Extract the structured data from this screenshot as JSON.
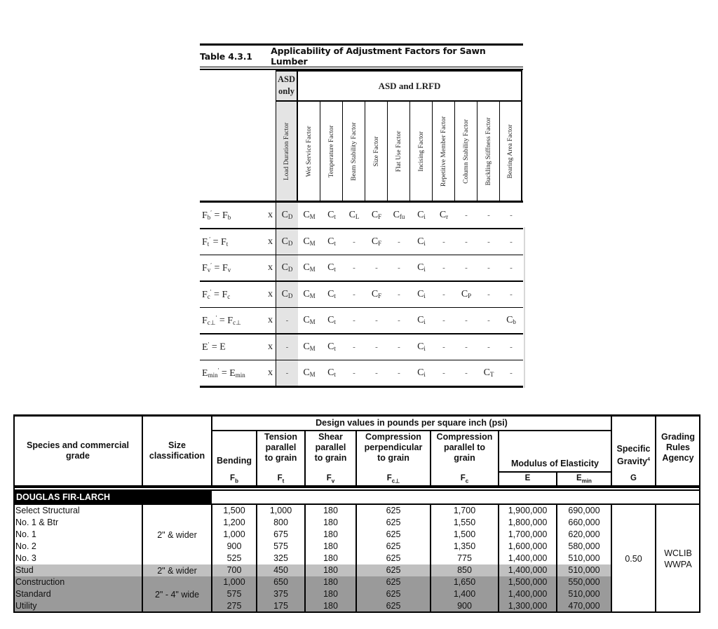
{
  "adjustment_table": {
    "table_number": "Table 4.3.1",
    "title": "Applicability of Adjustment Factors for Sawn Lumber",
    "group_headers": {
      "asd_only": [
        "ASD",
        "only"
      ],
      "asd_and_lrfd": "ASD and LRFD"
    },
    "factor_columns": [
      "Load Duration Factor",
      "Wet Service Factor",
      "Temperature Factor",
      "Beam Stability Factor",
      "Size Factor",
      "Flat Use Factor",
      "Incising Factor",
      "Repetitive Member Factor",
      "Column Stability Factor",
      "Buckling Stiffness Factor",
      "Bearing Area Factor"
    ],
    "multiply_symbol": "x",
    "rows": [
      {
        "lhs": "F",
        "lhs_sub": "b",
        "rhs": "F",
        "rhs_sub": "b",
        "cells": [
          [
            "C",
            "D"
          ],
          [
            "C",
            "M"
          ],
          [
            "C",
            "t"
          ],
          [
            "C",
            "L"
          ],
          [
            "C",
            "F"
          ],
          [
            "C",
            "fu"
          ],
          [
            "C",
            "i"
          ],
          [
            "C",
            "r"
          ],
          [
            "-",
            ""
          ],
          [
            "-",
            ""
          ],
          [
            "-",
            ""
          ]
        ]
      },
      {
        "lhs": "F",
        "lhs_sub": "t",
        "rhs": "F",
        "rhs_sub": "t",
        "cells": [
          [
            "C",
            "D"
          ],
          [
            "C",
            "M"
          ],
          [
            "C",
            "t"
          ],
          [
            "-",
            ""
          ],
          [
            "C",
            "F"
          ],
          [
            "-",
            ""
          ],
          [
            "C",
            "i"
          ],
          [
            "-",
            ""
          ],
          [
            "-",
            ""
          ],
          [
            "-",
            ""
          ],
          [
            "-",
            ""
          ]
        ]
      },
      {
        "lhs": "F",
        "lhs_sub": "v",
        "rhs": "F",
        "rhs_sub": "v",
        "cells": [
          [
            "C",
            "D"
          ],
          [
            "C",
            "M"
          ],
          [
            "C",
            "t"
          ],
          [
            "-",
            ""
          ],
          [
            "-",
            ""
          ],
          [
            "-",
            ""
          ],
          [
            "C",
            "i"
          ],
          [
            "-",
            ""
          ],
          [
            "-",
            ""
          ],
          [
            "-",
            ""
          ],
          [
            "-",
            ""
          ]
        ]
      },
      {
        "lhs": "F",
        "lhs_sub": "c",
        "rhs": "F",
        "rhs_sub": "c",
        "cells": [
          [
            "C",
            "D"
          ],
          [
            "C",
            "M"
          ],
          [
            "C",
            "t"
          ],
          [
            "-",
            ""
          ],
          [
            "C",
            "F"
          ],
          [
            "-",
            ""
          ],
          [
            "C",
            "i"
          ],
          [
            "-",
            ""
          ],
          [
            "C",
            "P"
          ],
          [
            "-",
            ""
          ],
          [
            "-",
            ""
          ]
        ]
      },
      {
        "lhs": "F",
        "lhs_sub": "c⊥",
        "rhs": "F",
        "rhs_sub": "c⊥",
        "cells": [
          [
            "-",
            ""
          ],
          [
            "C",
            "M"
          ],
          [
            "C",
            "t"
          ],
          [
            "-",
            ""
          ],
          [
            "-",
            ""
          ],
          [
            "-",
            ""
          ],
          [
            "C",
            "i"
          ],
          [
            "-",
            ""
          ],
          [
            "-",
            ""
          ],
          [
            "-",
            ""
          ],
          [
            "C",
            "b"
          ]
        ]
      },
      {
        "lhs": "E",
        "lhs_sub": "",
        "rhs": "E",
        "rhs_sub": "",
        "cells": [
          [
            "-",
            ""
          ],
          [
            "C",
            "M"
          ],
          [
            "C",
            "t"
          ],
          [
            "-",
            ""
          ],
          [
            "-",
            ""
          ],
          [
            "-",
            ""
          ],
          [
            "C",
            "i"
          ],
          [
            "-",
            ""
          ],
          [
            "-",
            ""
          ],
          [
            "-",
            ""
          ],
          [
            "-",
            ""
          ]
        ]
      },
      {
        "lhs": "E",
        "lhs_sub": "min",
        "rhs": "E",
        "rhs_sub": "min",
        "cells": [
          [
            "-",
            ""
          ],
          [
            "C",
            "M"
          ],
          [
            "C",
            "t"
          ],
          [
            "-",
            ""
          ],
          [
            "-",
            ""
          ],
          [
            "-",
            ""
          ],
          [
            "C",
            "i"
          ],
          [
            "-",
            ""
          ],
          [
            "-",
            ""
          ],
          [
            "C",
            "T"
          ],
          [
            "-",
            ""
          ]
        ]
      }
    ]
  },
  "design_values_table": {
    "headers": {
      "species": "Species and commercial grade",
      "size": "Size classification",
      "design_values_group": "Design values in pounds per square inch (psi)",
      "bending": "Bending",
      "tension": "Tension parallel to grain",
      "shear": "Shear parallel to grain",
      "comp_perp": "Compression perpendicular to grain",
      "comp_par": "Compression parallel to grain",
      "modulus": "Modulus of Elasticity",
      "specific_gravity": "Specific Gravity",
      "specific_gravity_footnote": "4",
      "agency": "Grading Rules Agency"
    },
    "symbols": {
      "bending": {
        "base": "F",
        "sub": "b"
      },
      "tension": {
        "base": "F",
        "sub": "t"
      },
      "shear": {
        "base": "F",
        "sub": "v"
      },
      "comp_perp": {
        "base": "F",
        "sub": "c⊥"
      },
      "comp_par": {
        "base": "F",
        "sub": "c"
      },
      "e": {
        "base": "E",
        "sub": ""
      },
      "emin": {
        "base": "E",
        "sub": "min"
      },
      "g": {
        "base": "G",
        "sub": ""
      }
    },
    "species_name": "DOUGLAS FIR-LARCH",
    "size_groups": [
      {
        "label": "2\" & wider",
        "rows": 5
      },
      {
        "label": "2\" & wider",
        "rows": 1
      },
      {
        "label": "2\" - 4\" wide",
        "rows": 3
      }
    ],
    "specific_gravity": "0.50",
    "agency": [
      "WCLIB",
      "WWPA"
    ],
    "shade_colors": {
      "white": "#ffffff",
      "stud": "#c0c0c0",
      "light_framing": "#9a9a9a"
    },
    "rows": [
      {
        "grade": "Select Structural",
        "fb": "1,500",
        "ft": "1,000",
        "fv": "180",
        "fcp": "625",
        "fc": "1,700",
        "e": "1,900,000",
        "emin": "690,000",
        "shade": "white"
      },
      {
        "grade": "No. 1 & Btr",
        "fb": "1,200",
        "ft": "800",
        "fv": "180",
        "fcp": "625",
        "fc": "1,550",
        "e": "1,800,000",
        "emin": "660,000",
        "shade": "white"
      },
      {
        "grade": "No. 1",
        "fb": "1,000",
        "ft": "675",
        "fv": "180",
        "fcp": "625",
        "fc": "1,500",
        "e": "1,700,000",
        "emin": "620,000",
        "shade": "white"
      },
      {
        "grade": "No. 2",
        "fb": "900",
        "ft": "575",
        "fv": "180",
        "fcp": "625",
        "fc": "1,350",
        "e": "1,600,000",
        "emin": "580,000",
        "shade": "white"
      },
      {
        "grade": "No. 3",
        "fb": "525",
        "ft": "325",
        "fv": "180",
        "fcp": "625",
        "fc": "775",
        "e": "1,400,000",
        "emin": "510,000",
        "shade": "white"
      },
      {
        "grade": "Stud",
        "fb": "700",
        "ft": "450",
        "fv": "180",
        "fcp": "625",
        "fc": "850",
        "e": "1,400,000",
        "emin": "510,000",
        "shade": "stud"
      },
      {
        "grade": "Construction",
        "fb": "1,000",
        "ft": "650",
        "fv": "180",
        "fcp": "625",
        "fc": "1,650",
        "e": "1,500,000",
        "emin": "550,000",
        "shade": "light_framing"
      },
      {
        "grade": "Standard",
        "fb": "575",
        "ft": "375",
        "fv": "180",
        "fcp": "625",
        "fc": "1,400",
        "e": "1,400,000",
        "emin": "510,000",
        "shade": "light_framing"
      },
      {
        "grade": "Utility",
        "fb": "275",
        "ft": "175",
        "fv": "180",
        "fcp": "625",
        "fc": "900",
        "e": "1,300,000",
        "emin": "470,000",
        "shade": "light_framing"
      }
    ]
  }
}
